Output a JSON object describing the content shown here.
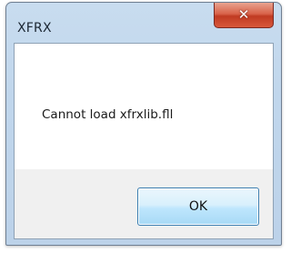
{
  "window": {
    "title": "XFRX",
    "close_icon": "close-icon",
    "close_glyph": "✕"
  },
  "dialog": {
    "message": "Cannot load xfrxlib.fll",
    "ok_label": "OK"
  },
  "colors": {
    "close_button": "#c74a32",
    "ok_button_border": "#3c7fb1",
    "frame": "#c0d6ec"
  }
}
